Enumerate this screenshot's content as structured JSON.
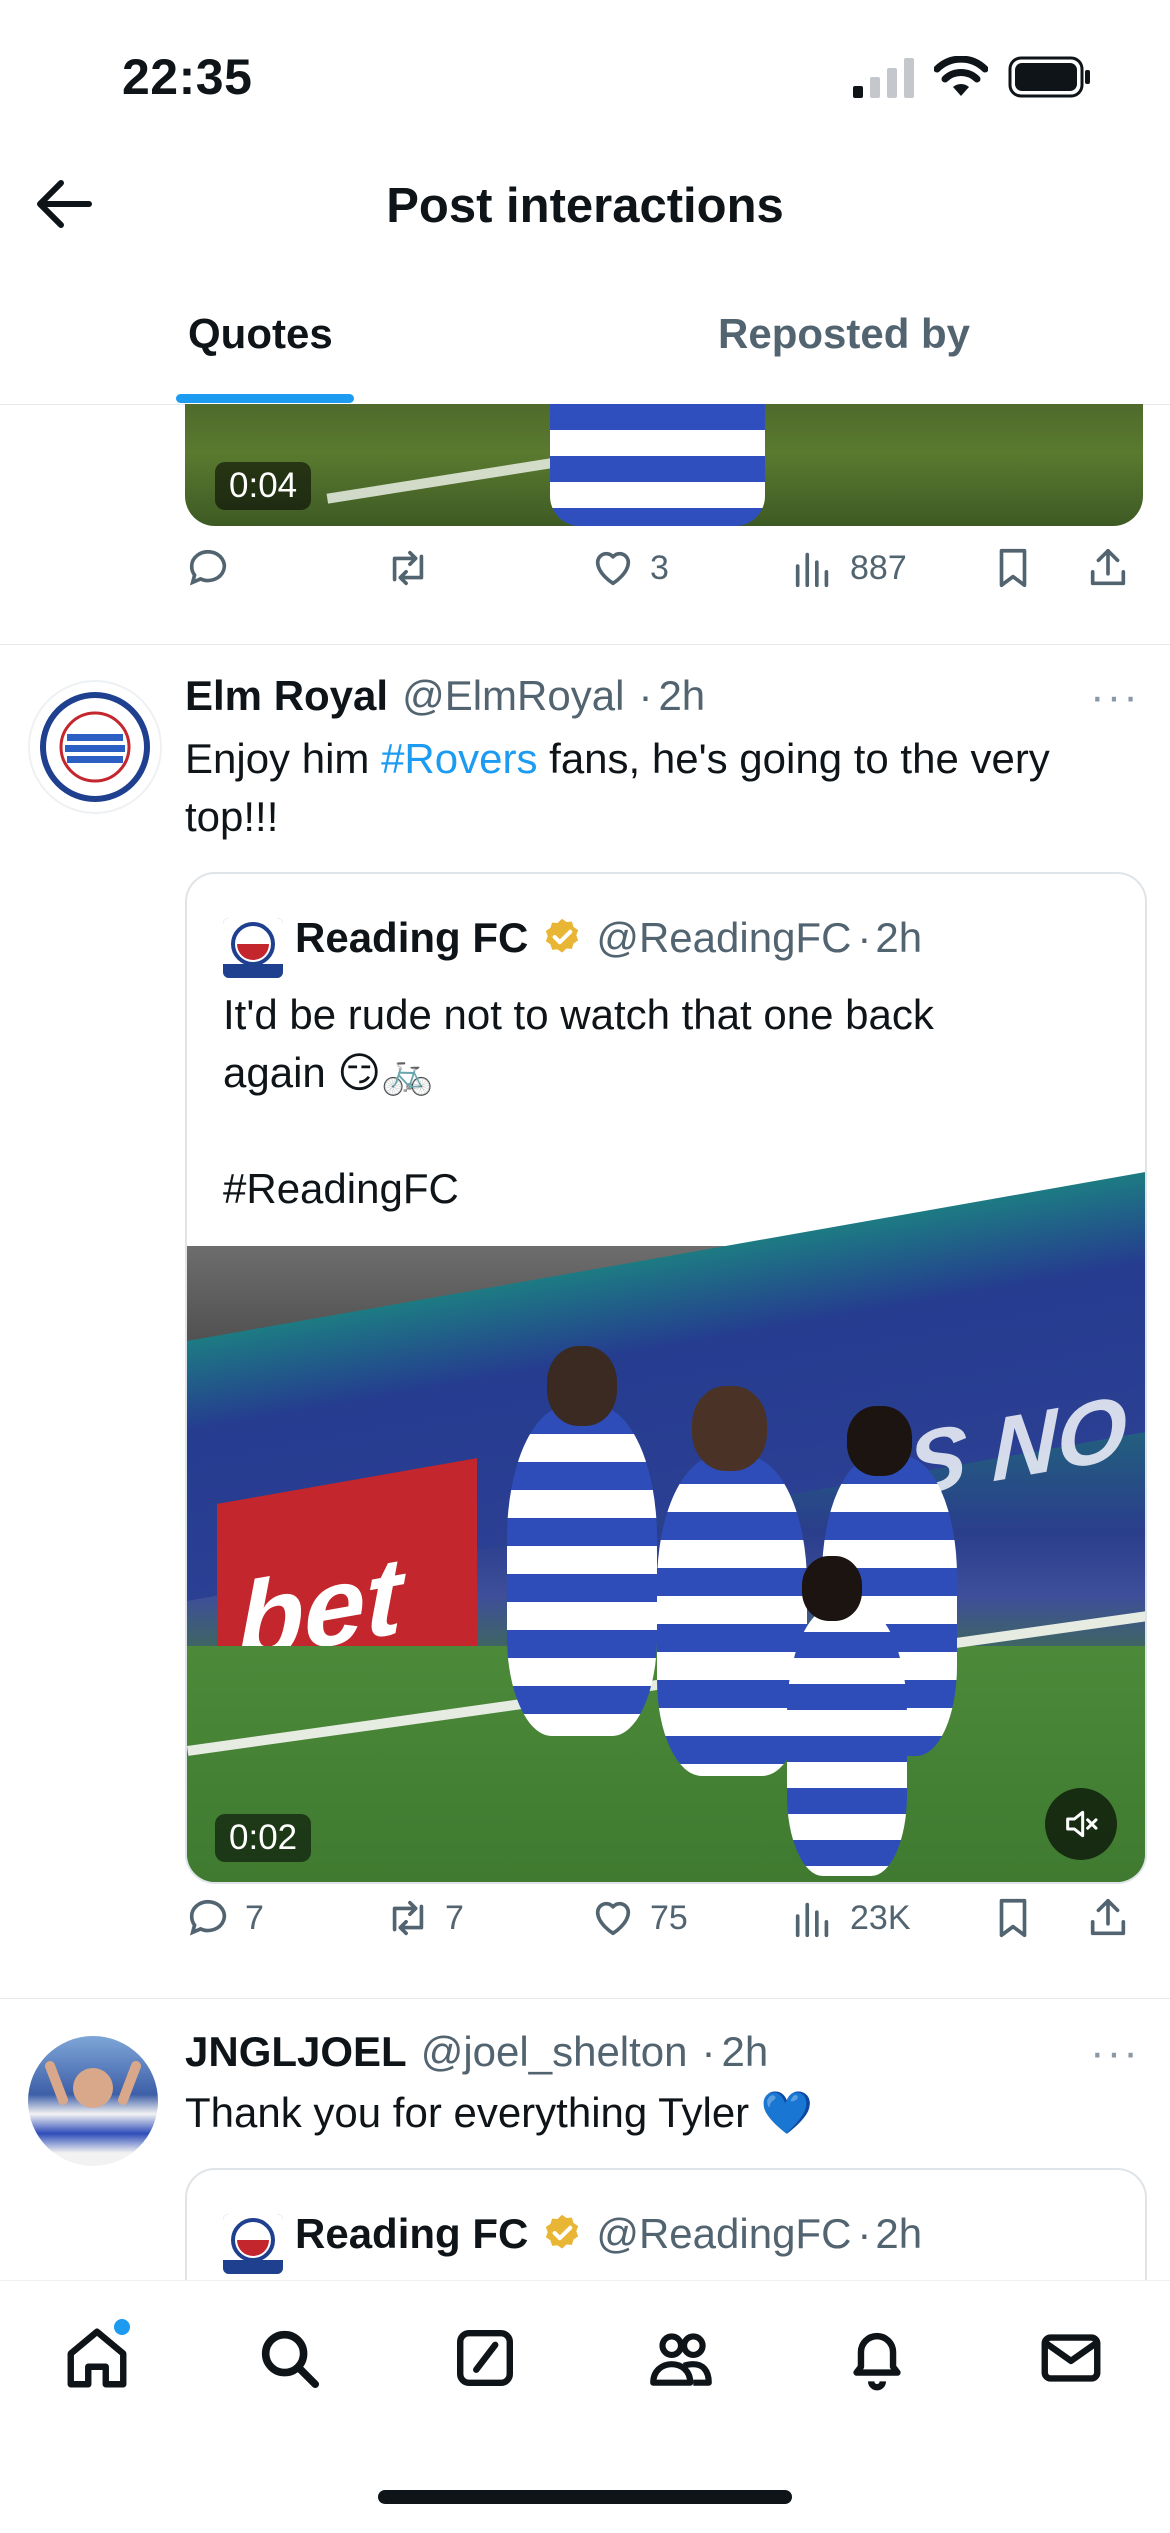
{
  "status": {
    "time": "22:35"
  },
  "header": {
    "title": "Post interactions"
  },
  "tabs": [
    {
      "label": "Quotes"
    },
    {
      "label": "Reposted by"
    }
  ],
  "top_post": {
    "video_duration": "0:04",
    "replies": "",
    "reposts": "",
    "likes": "3",
    "views": "887"
  },
  "post1": {
    "name": "Elm Royal",
    "handle": "@ElmRoyal",
    "time": "2h",
    "text_before": "Enjoy him ",
    "hashtag": "#Rovers",
    "text_after": " fans, he's going to the very top!!!",
    "quote": {
      "name": "Reading FC",
      "handle": "@ReadingFC",
      "time": "2h",
      "line1": "It'd be rude not to watch that one back",
      "line2": "again 😏🚲",
      "hashtag": "#ReadingFC",
      "video_duration": "0:02",
      "ad_text": "bet",
      "banner_text": "S NO"
    },
    "replies": "7",
    "reposts": "7",
    "likes": "75",
    "views": "23K"
  },
  "post2": {
    "name": "JNGLJOEL",
    "handle": "@joel_shelton",
    "time": "2h",
    "text": "Thank you for everything Tyler 💙",
    "quote": {
      "name": "Reading FC",
      "handle": "@ReadingFC",
      "time": "2h"
    }
  },
  "colors": {
    "accent": "#1d9bf0",
    "text": "#0f1419",
    "muted": "#536471",
    "verified": "#e8b634"
  }
}
